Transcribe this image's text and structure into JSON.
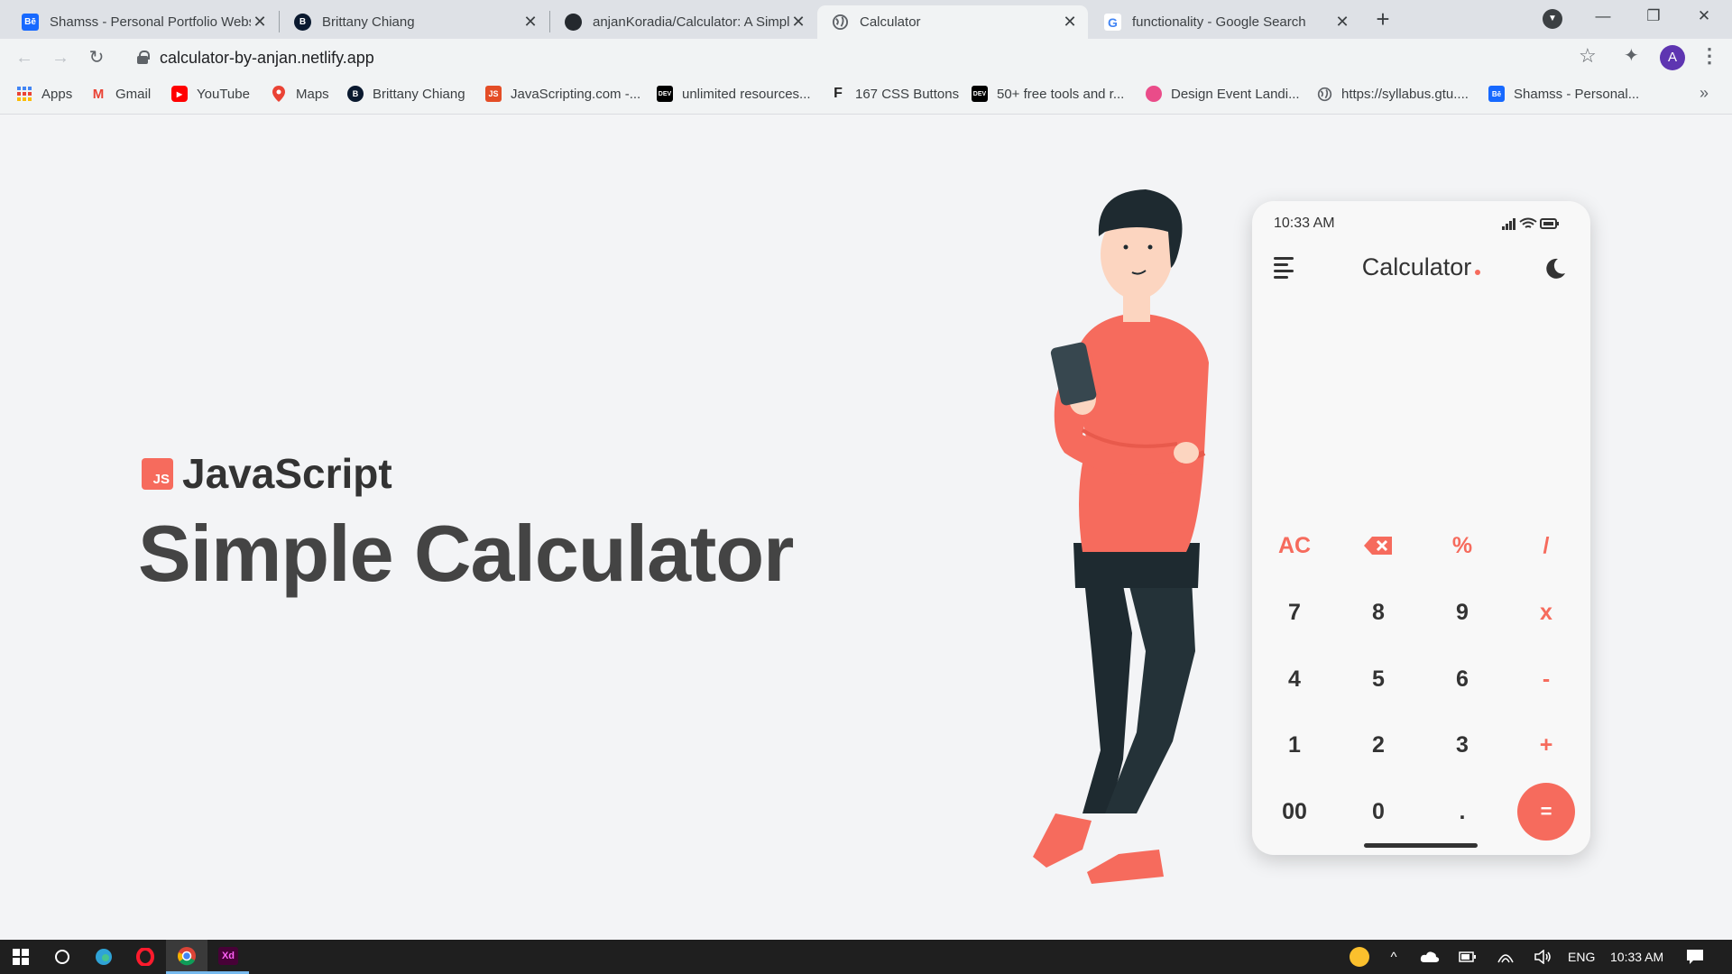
{
  "browser": {
    "tabs": [
      {
        "title": "Shamss - Personal Portfolio Website",
        "favicon": "behance-icon",
        "color": "#1769ff",
        "glyph": "Bē",
        "active": false
      },
      {
        "title": "Brittany Chiang",
        "favicon": "hexagon-b-icon",
        "color": "#0a192f",
        "glyph": "B",
        "active": false
      },
      {
        "title": "anjanKoradia/Calculator: A Simple Calculator",
        "favicon": "github-icon",
        "color": "#24292e",
        "glyph": "",
        "active": false
      },
      {
        "title": "Calculator",
        "favicon": "globe-icon",
        "color": "#5f6368",
        "glyph": "",
        "active": true
      },
      {
        "title": "functionality - Google Search",
        "favicon": "google-icon",
        "color": "#4285f4",
        "glyph": "G",
        "active": false
      }
    ],
    "url": "calculator-by-anjan.netlify.app",
    "profile_initial": "A",
    "bookmarks": [
      {
        "label": "Apps",
        "icon": "apps-grid-icon",
        "color": "#4285f4"
      },
      {
        "label": "Gmail",
        "icon": "gmail-icon",
        "color": "#ea4335"
      },
      {
        "label": "YouTube",
        "icon": "youtube-icon",
        "color": "#ff0000"
      },
      {
        "label": "Maps",
        "icon": "maps-icon",
        "color": "#34a853"
      },
      {
        "label": "Brittany Chiang",
        "icon": "hexagon-b-icon",
        "color": "#0a192f"
      },
      {
        "label": "JavaScripting.com -...",
        "icon": "javascripting-icon",
        "color": "#e44d26"
      },
      {
        "label": "unlimited resources...",
        "icon": "dev-icon",
        "color": "#000000"
      },
      {
        "label": "167 CSS Buttons",
        "icon": "f-icon",
        "color": "#222222"
      },
      {
        "label": "50+ free tools and r...",
        "icon": "dev-icon",
        "color": "#000000"
      },
      {
        "label": "Design Event Landi...",
        "icon": "dribbble-icon",
        "color": "#ea4c89"
      },
      {
        "label": "https://syllabus.gtu....",
        "icon": "globe-icon",
        "color": "#5f6368"
      },
      {
        "label": "Shamss - Personal...",
        "icon": "behance-icon",
        "color": "#1769ff"
      }
    ]
  },
  "page": {
    "badge": "JS",
    "subtitle": "JavaScript",
    "title": "Simple Calculator",
    "accent_color": "#f66b5d"
  },
  "calculator": {
    "time": "10:33 AM",
    "title": "Calculator",
    "keys": [
      [
        "AC",
        "⌫",
        "%",
        "/"
      ],
      [
        "7",
        "8",
        "9",
        "x"
      ],
      [
        "4",
        "5",
        "6",
        "-"
      ],
      [
        "1",
        "2",
        "3",
        "+"
      ],
      [
        "00",
        "0",
        ".",
        "="
      ]
    ]
  },
  "taskbar": {
    "language": "ENG",
    "time": "10:33 AM"
  }
}
